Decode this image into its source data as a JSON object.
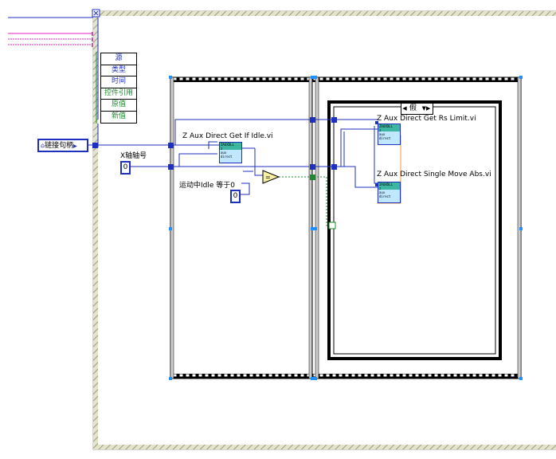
{
  "case_structure": {
    "selector_value": "假",
    "left_arrow": "◀",
    "right_arrow": "▼▶"
  },
  "unbundle_node": {
    "items": [
      "源",
      "类型",
      "时间",
      "控件引用",
      "原值",
      "新值"
    ],
    "item_colors": [
      "#1f2fbf",
      "#1f2fbf",
      "#1f2fbf",
      "#1d8a2e",
      "#1d8a2e",
      "#1d8a2e"
    ]
  },
  "controls": {
    "link_handle": "链接句柄",
    "x_axis_label": "X轴轴号",
    "x_axis_value": "0",
    "idle_compare_label": "运动中Idle 等于0",
    "idle_compare_value": "0"
  },
  "subvis": {
    "get_idle": "Z Aux Direct Get If Idle.vi",
    "get_rs_limit": "Z Aux Direct Get Rs Limit.vi",
    "single_move": "Z Aux Direct Single Move Abs.vi",
    "icon_text": [
      "ZAUXDLL",
      "z",
      "aux",
      "direct"
    ]
  },
  "colors": {
    "wire_blue": "#1f2fbf",
    "wire_green": "#1d8a2e",
    "event_pink": "#e81fc8",
    "frame_border": "#000000",
    "event_frame": "#c8c8a8"
  }
}
